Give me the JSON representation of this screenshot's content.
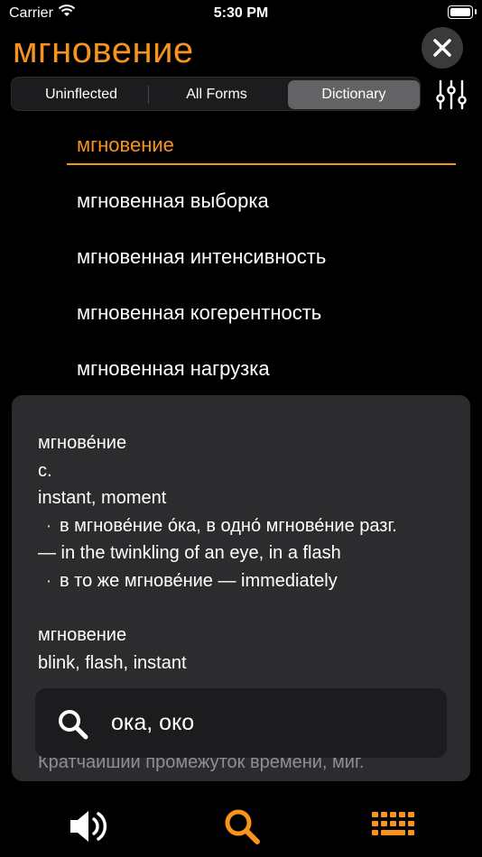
{
  "status": {
    "carrier": "Carrier",
    "time": "5:30 PM"
  },
  "header": {
    "headword": "мгновение"
  },
  "segments": [
    {
      "label": "Uninflected",
      "selected": false
    },
    {
      "label": "All Forms",
      "selected": false
    },
    {
      "label": "Dictionary",
      "selected": true
    }
  ],
  "results": [
    "мгновение",
    "мгновенная выборка",
    "мгновенная интенсивность",
    "мгновенная когерентность",
    "мгновенная нагрузка"
  ],
  "entry": {
    "block1": {
      "headword": "мгнове́ние",
      "pos": "с.",
      "translation": "instant, moment",
      "example1_ru": "в мгнове́ние о́ка, в одно́ мгнове́ние разг.",
      "example1_en": "— in the twinkling of an eye, in a flash",
      "example2": "в то же мгнове́ние — immediately"
    },
    "block2": {
      "headword": "мгновение",
      "translation": "blink, flash, instant"
    },
    "faded_line": "Кратчайший промежуток времени, миг."
  },
  "search": {
    "query": "ока, око"
  },
  "tabbar": {
    "icons": [
      "speaker-icon",
      "search-icon",
      "keyboard-icon"
    ]
  },
  "colors": {
    "accent": "#f7931e",
    "background": "#000000",
    "panel": "#2c2c2e"
  }
}
